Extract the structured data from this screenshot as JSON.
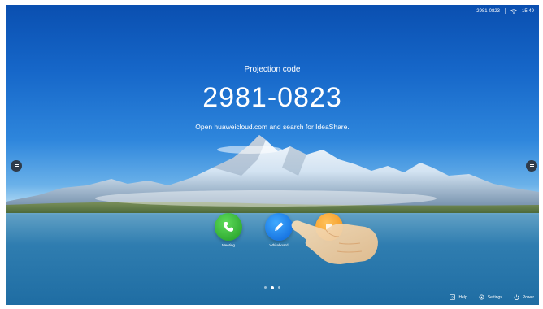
{
  "status_bar": {
    "code": "2981-0823",
    "wifi_icon": "wifi-icon",
    "time": "15:49"
  },
  "projection": {
    "title": "Projection code",
    "code": "2981-0823",
    "hint": "Open huaweicloud.com and search for IdeaShare."
  },
  "apps": [
    {
      "label": "Meeting",
      "icon": "phone-icon",
      "color": "#2fb534"
    },
    {
      "label": "Whiteboard",
      "icon": "pen-icon",
      "color": "#1a7cf0"
    },
    {
      "label": "",
      "icon": "app-icon",
      "color": "#f5a623"
    }
  ],
  "pager": {
    "count": 3,
    "active": 2
  },
  "bottom_bar": {
    "help": "Help",
    "settings": "Settings",
    "power": "Power"
  },
  "side_buttons": {
    "left_icon": "menu-icon",
    "right_icon": "menu-icon"
  }
}
